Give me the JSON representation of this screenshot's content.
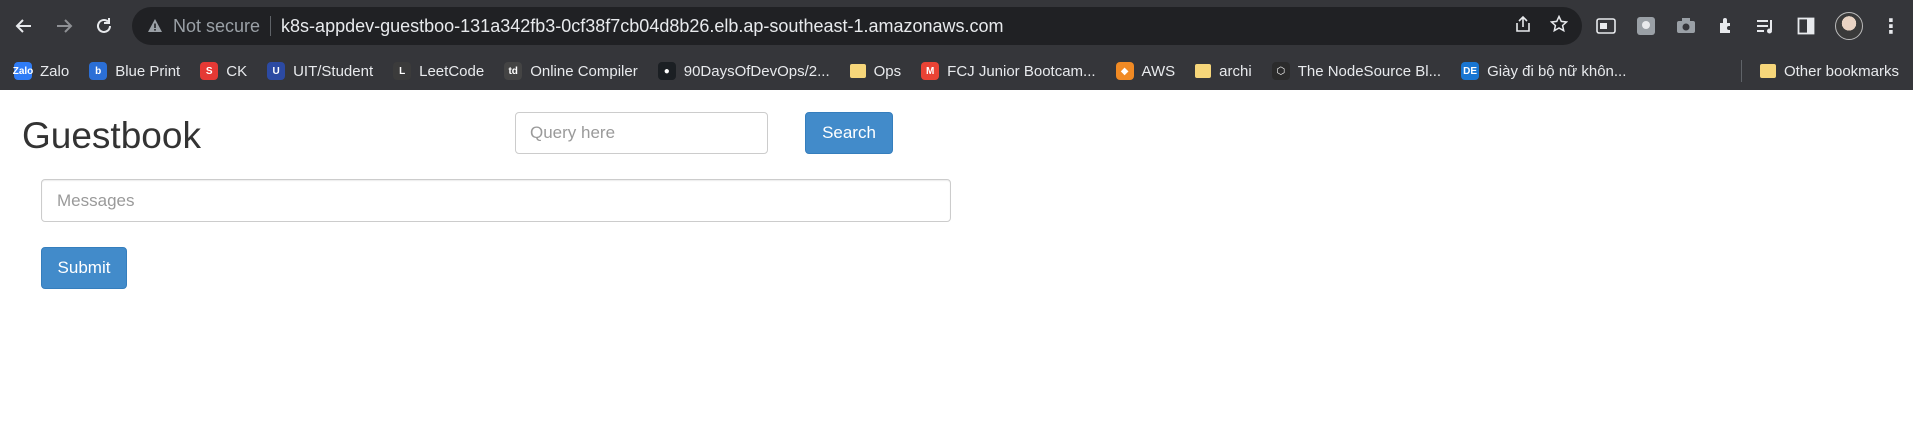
{
  "browser": {
    "security_status": "Not secure",
    "url": "k8s-appdev-guestboo-131a342fb3-0cf38f7cb04d8b26.elb.ap-southeast-1.amazonaws.com",
    "icons": [
      "back-icon",
      "forward-icon",
      "reload-icon",
      "warning-icon",
      "share-icon",
      "star-icon",
      "media-icon",
      "puzzle-icon",
      "camera-icon",
      "extensions-icon",
      "playlist-icon",
      "sidepanel-icon",
      "avatar",
      "kebab-icon"
    ]
  },
  "bookmarks": {
    "items": [
      {
        "label": "Zalo",
        "fav_text": "Zalo",
        "color": "#2f7cf6"
      },
      {
        "label": "Blue Print",
        "fav_text": "b",
        "color": "#2b6fd6"
      },
      {
        "label": "CK",
        "fav_text": "S",
        "color": "#e53935"
      },
      {
        "label": "UIT/Student",
        "fav_text": "U",
        "color": "#2c4aa3"
      },
      {
        "label": "LeetCode",
        "fav_text": "L",
        "color": "#3b3b3b"
      },
      {
        "label": "Online Compiler",
        "fav_text": "td",
        "color": "#444444"
      },
      {
        "label": "90DaysOfDevOps/2...",
        "fav_text": "●",
        "color": "#1b1f23"
      },
      {
        "label": "Ops",
        "fav_text": "",
        "color": "folder"
      },
      {
        "label": "FCJ Junior Bootcam...",
        "fav_text": "M",
        "color": "#ea4335"
      },
      {
        "label": "AWS",
        "fav_text": "◆",
        "color": "#f08a24"
      },
      {
        "label": "archi",
        "fav_text": "",
        "color": "folder"
      },
      {
        "label": "The NodeSource Bl...",
        "fav_text": "⬡",
        "color": "#2b2b2b"
      },
      {
        "label": "Giày đi bộ nữ khôn...",
        "fav_text": "DE",
        "color": "#1976d2"
      }
    ],
    "other": "Other bookmarks"
  },
  "page": {
    "title": "Guestbook",
    "query_placeholder": "Query here",
    "search_label": "Search",
    "messages_placeholder": "Messages",
    "submit_label": "Submit"
  },
  "colors": {
    "chrome_bg": "#35363a",
    "omnibox_bg": "#202124",
    "primary_button": "#428bca",
    "title_text": "#333333"
  }
}
